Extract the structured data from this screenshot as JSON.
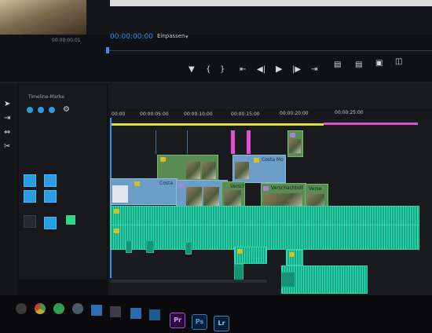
{
  "monitor": {
    "timecode": "00:00:00:00",
    "fit_label": "Einpassen",
    "source_timecode": "00:00:00:01"
  },
  "sequence": {
    "tab_label": "Timeline-Marke"
  },
  "ruler": {
    "labels": [
      "00:00",
      "00:00:05:00",
      "00:00:10:00",
      "00:00:15:00",
      "00:00:20:00",
      "00:00:25:00"
    ]
  },
  "clips": {
    "c1_label": "Costa",
    "c2_label": "Costa Mo",
    "c3_label": "Versch",
    "c4_label": "Verschachtelt",
    "c5_label": "Verse"
  },
  "taskbar": {
    "pr_label": "Pr",
    "ps_label": "Ps",
    "lr_label": "Lr"
  },
  "colors": {
    "accent_blue": "#3a8ff0",
    "video_clip": "#6a9ec9",
    "audio_clip": "#1fbf94",
    "marker_pink": "#e04fd0",
    "work_area_yellow": "#e0dc3a"
  }
}
